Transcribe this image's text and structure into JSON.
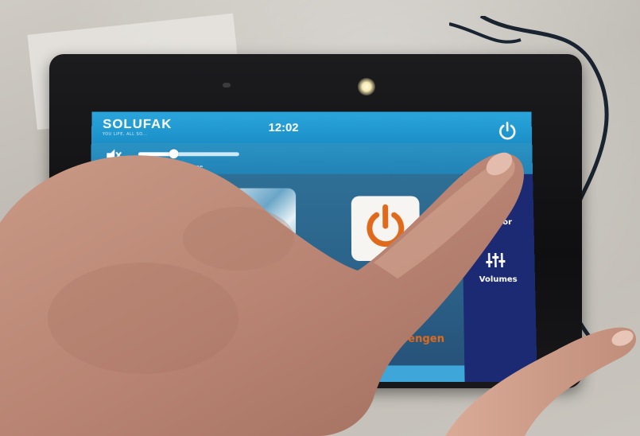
{
  "device_screen": {
    "logo": "SOLUFAK",
    "logo_subtitle": "YOU LIFE, ALL SO...",
    "time": "12:02",
    "volume_label": "bron volume",
    "volume_level": 0.35,
    "tile_label_partial": "engen",
    "sidebar_item_1": "ctor",
    "sidebar_item_2": "Volumes"
  },
  "colors": {
    "topbar": "#2aa5dc",
    "sidebar": "#1b2a72",
    "accent_orange": "#e06a1c"
  },
  "icons": [
    "power-icon",
    "mute-icon",
    "equalizer-icon"
  ]
}
